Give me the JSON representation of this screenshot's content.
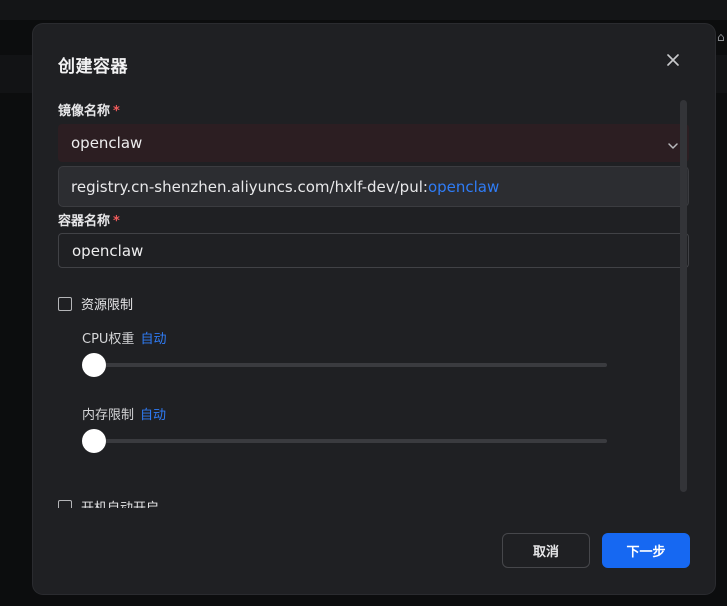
{
  "dialog": {
    "title": "创建容器",
    "close_icon": "close-icon"
  },
  "form": {
    "image_name": {
      "label": "镜像名称",
      "required_mark": "*",
      "value": "openclaw",
      "suggestion_prefix": "registry.cn-shenzhen.aliyuncs.com/hxlf-dev/pul:",
      "suggestion_match": "openclaw"
    },
    "container_name": {
      "label": "容器名称",
      "required_mark": "*",
      "value": "openclaw"
    },
    "resource_limit": {
      "label": "资源限制",
      "checked": false
    },
    "cpu_weight": {
      "label": "CPU权重",
      "mode": "自动",
      "value_fraction": 0
    },
    "memory_limit": {
      "label": "内存限制",
      "mode": "自动",
      "value_fraction": 0
    },
    "auto_start": {
      "label": "开机自动开启",
      "checked": false
    }
  },
  "footer": {
    "cancel_label": "取消",
    "next_label": "下一步"
  },
  "colors": {
    "accent": "#1668f2",
    "link": "#2f7cf6",
    "required": "#f05b5b",
    "dialog_bg": "#1f2023"
  }
}
